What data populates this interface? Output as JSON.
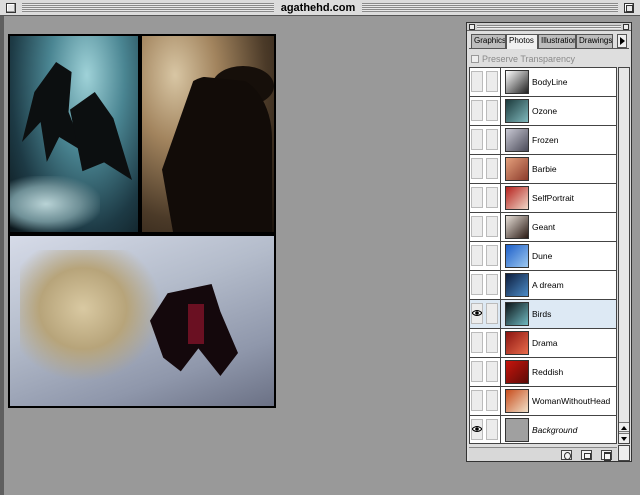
{
  "window": {
    "title": "agathehd.com"
  },
  "palette": {
    "tabs": [
      {
        "label": "Graphics",
        "active": false
      },
      {
        "label": "Photos",
        "active": true
      },
      {
        "label": "Illustrations",
        "active": false
      },
      {
        "label": "Drawings",
        "active": false
      }
    ],
    "preserve_transparency": {
      "label": "Preserve Transparency",
      "checked": false,
      "enabled": false
    },
    "layers": [
      {
        "name": "BodyLine",
        "visible": false,
        "selected": false,
        "thumb": [
          "#ffffff",
          "#222222"
        ]
      },
      {
        "name": "Ozone",
        "visible": false,
        "selected": false,
        "thumb": [
          "#1c3a3c",
          "#7fb8bc"
        ]
      },
      {
        "name": "Frozen",
        "visible": false,
        "selected": false,
        "thumb": [
          "#c9c9d4",
          "#4a4a58"
        ]
      },
      {
        "name": "Barbie",
        "visible": false,
        "selected": false,
        "thumb": [
          "#e4a07c",
          "#8c3c2c"
        ]
      },
      {
        "name": "SelfPortrait",
        "visible": false,
        "selected": false,
        "thumb": [
          "#b6201c",
          "#f0d8c8"
        ]
      },
      {
        "name": "Geant",
        "visible": false,
        "selected": false,
        "thumb": [
          "#e8e0d8",
          "#2a1a14"
        ]
      },
      {
        "name": "Dune",
        "visible": false,
        "selected": false,
        "thumb": [
          "#1c5ec8",
          "#9cc8f0"
        ]
      },
      {
        "name": "A dream",
        "visible": false,
        "selected": false,
        "thumb": [
          "#0c1c3c",
          "#4c8cc8"
        ]
      },
      {
        "name": "Birds",
        "visible": true,
        "selected": true,
        "thumb": [
          "#0c1418",
          "#6fb8c0"
        ]
      },
      {
        "name": "Drama",
        "visible": false,
        "selected": false,
        "thumb": [
          "#8c1410",
          "#e86c4c"
        ]
      },
      {
        "name": "Reddish",
        "visible": false,
        "selected": false,
        "thumb": [
          "#c8140c",
          "#5c0c08"
        ]
      },
      {
        "name": "WomanWithoutHead",
        "visible": false,
        "selected": false,
        "thumb": [
          "#c84c1c",
          "#f0e0c8"
        ]
      },
      {
        "name": "Background",
        "visible": true,
        "selected": false,
        "italic": true,
        "thumb": [
          "#a0a0a0",
          "#a0a0a0"
        ]
      }
    ]
  },
  "colors": {
    "canvas_bg": "#999999",
    "selected_row": "#dde9f4"
  }
}
